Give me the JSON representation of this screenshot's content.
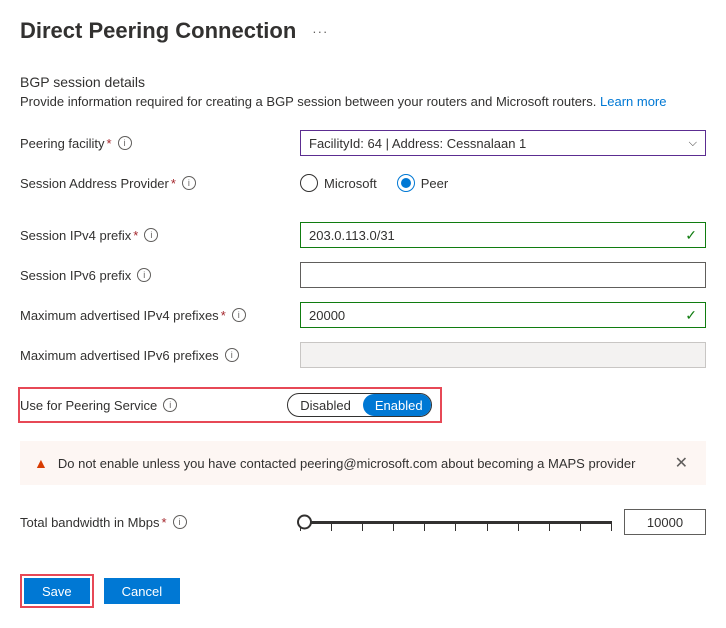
{
  "header": {
    "title": "Direct Peering Connection",
    "ellipsis": "···"
  },
  "section": {
    "title": "BGP session details",
    "desc": "Provide information required for creating a BGP session between your routers and Microsoft routers. ",
    "learn_more": "Learn more"
  },
  "labels": {
    "facility": "Peering facility",
    "session_provider": "Session Address Provider",
    "ipv4_prefix": "Session IPv4 prefix",
    "ipv6_prefix": "Session IPv6 prefix",
    "max_ipv4": "Maximum advertised IPv4 prefixes",
    "max_ipv6": "Maximum advertised IPv6 prefixes",
    "peering_service": "Use for Peering Service",
    "bandwidth": "Total bandwidth in Mbps"
  },
  "values": {
    "facility": "FacilityId: 64 | Address: Cessnalaan 1",
    "ipv4_prefix": "203.0.113.0/31",
    "max_ipv4": "20000",
    "bandwidth": "10000"
  },
  "radios": {
    "microsoft": "Microsoft",
    "peer": "Peer"
  },
  "toggle": {
    "off": "Disabled",
    "on": "Enabled"
  },
  "banner": {
    "text": "Do not enable unless you have contacted peering@microsoft.com about becoming a MAPS provider"
  },
  "buttons": {
    "save": "Save",
    "cancel": "Cancel"
  },
  "glyphs": {
    "info": "i",
    "check": "✓",
    "warn": "▲",
    "close": "✕",
    "chev": "⌵"
  }
}
